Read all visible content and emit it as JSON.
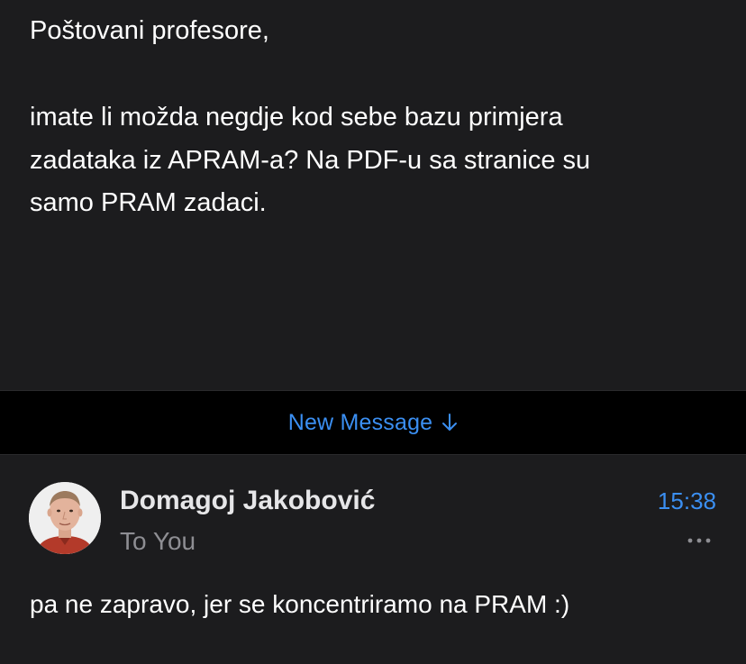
{
  "previous_message": {
    "lines": [
      "Poštovani profesore,",
      "imate li možda negdje kod sebe bazu primjera",
      "zadataka iz APRAM-a? Na PDF-u sa stranice su",
      "samo PRAM zadaci."
    ]
  },
  "new_message_bar": {
    "label": "New Message",
    "icon": "arrow-down-icon"
  },
  "message": {
    "sender": "Domagoj Jakobović",
    "recipient": "To You",
    "time": "15:38",
    "body": "pa ne zapravo, jer se koncentriramo na PRAM :)",
    "avatar_icon": "avatar",
    "more_icon": "more-icon"
  },
  "colors": {
    "background": "#1c1c1e",
    "bar_background": "#000000",
    "accent": "#3b8ff2",
    "primary_text": "#ffffff",
    "secondary_text": "#8e8e93"
  }
}
